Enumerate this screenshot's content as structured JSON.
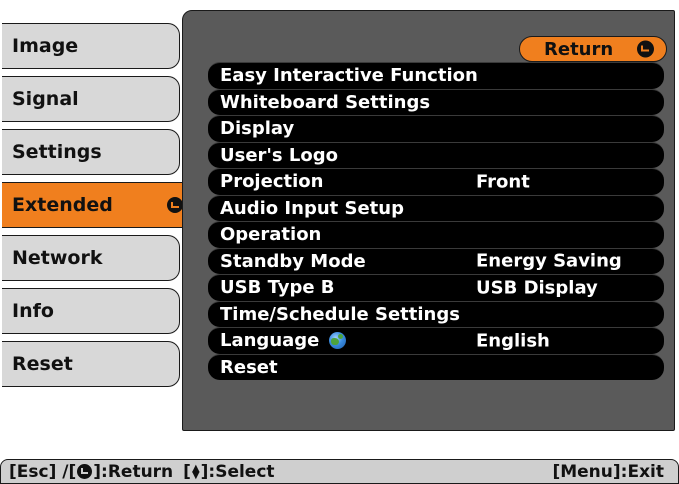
{
  "tabs": [
    {
      "label": "Image",
      "active": false
    },
    {
      "label": "Signal",
      "active": false
    },
    {
      "label": "Settings",
      "active": false
    },
    {
      "label": "Extended",
      "active": true
    },
    {
      "label": "Network",
      "active": false
    },
    {
      "label": "Info",
      "active": false
    },
    {
      "label": "Reset",
      "active": false
    }
  ],
  "return_button": {
    "label": "Return",
    "icon": "enter-icon"
  },
  "menu": [
    {
      "label": "Easy Interactive Function",
      "value": ""
    },
    {
      "label": "Whiteboard Settings",
      "value": ""
    },
    {
      "label": "Display",
      "value": ""
    },
    {
      "label": "User's Logo",
      "value": ""
    },
    {
      "label": "Projection",
      "value": "Front"
    },
    {
      "label": "Audio Input Setup",
      "value": ""
    },
    {
      "label": "Operation",
      "value": ""
    },
    {
      "label": "Standby Mode",
      "value": "Energy Saving"
    },
    {
      "label": "USB Type B",
      "value": "USB Display"
    },
    {
      "label": "Time/Schedule Settings",
      "value": ""
    },
    {
      "label": "Language",
      "value": "English",
      "icon": "globe-icon"
    },
    {
      "label": "Reset",
      "value": ""
    }
  ],
  "helpbar": {
    "esc": "[Esc] /[",
    "return": "]:Return",
    "select_open": "[",
    "select": "]:Select",
    "exit": "[Menu]:Exit"
  },
  "colors": {
    "accent": "#f07f1e",
    "panel": "#5a5a5a",
    "tab": "#d8d8d8"
  }
}
